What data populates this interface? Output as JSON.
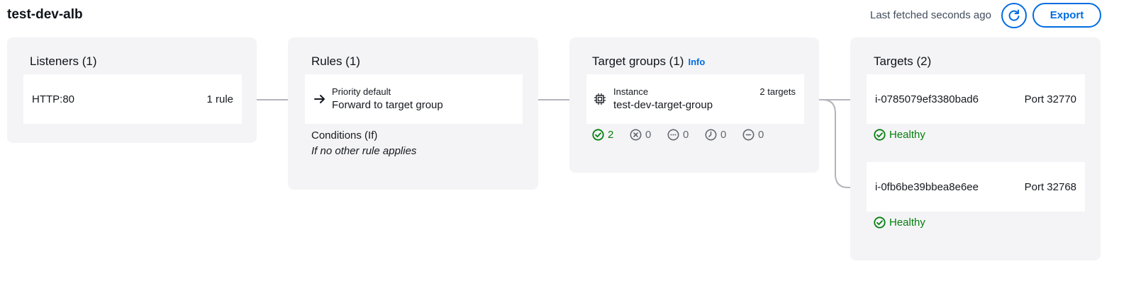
{
  "header": {
    "title": "test-dev-alb",
    "last_fetched": "Last fetched seconds ago",
    "export_label": "Export"
  },
  "listeners": {
    "title": "Listeners (1)",
    "items": [
      {
        "name": "HTTP:80",
        "rules": "1 rule"
      }
    ]
  },
  "rules": {
    "title": "Rules (1)",
    "items": [
      {
        "priority": "Priority default",
        "action": "Forward to target group"
      }
    ],
    "conditions_label": "Conditions (If)",
    "conditions_value": "If no other rule applies"
  },
  "target_groups": {
    "title": "Target groups (1)",
    "info_label": "Info",
    "items": [
      {
        "type": "Instance",
        "name": "test-dev-target-group",
        "count": "2 targets",
        "stats": {
          "healthy": "2",
          "unhealthy": "0",
          "unused": "0",
          "draining": "0",
          "unavailable": "0"
        }
      }
    ]
  },
  "targets": {
    "title": "Targets (2)",
    "items": [
      {
        "id": "i-0785079ef3380bad6",
        "port": "Port 32770",
        "status": "Healthy"
      },
      {
        "id": "i-0fb6be39bbea8e6ee",
        "port": "Port 32768",
        "status": "Healthy"
      }
    ]
  },
  "colors": {
    "accent": "#006ce0",
    "healthy": "#037f0c",
    "panel_bg": "#f4f4f6",
    "connector": "#b4b4bb"
  },
  "icons": [
    "refresh-icon",
    "arrow-right-icon",
    "instance-icon",
    "status-ok-icon",
    "status-error-icon",
    "status-pending-icon",
    "status-in-progress-icon",
    "status-stopped-icon"
  ]
}
